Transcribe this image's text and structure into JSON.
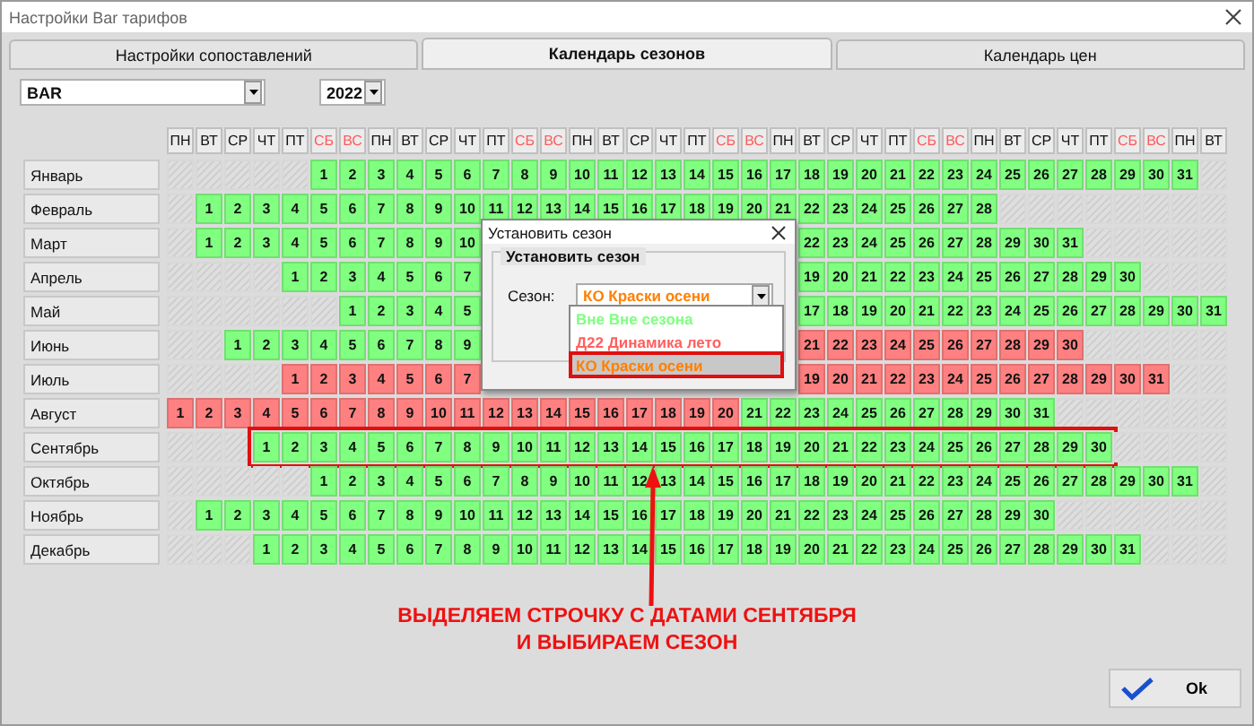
{
  "window": {
    "title": "Настройки Bar тарифов"
  },
  "tabs": [
    {
      "label": "Настройки сопоставлений",
      "selected": false
    },
    {
      "label": "Календарь сезонов",
      "selected": true
    },
    {
      "label": "Календарь цен",
      "selected": false
    }
  ],
  "tariff_select": {
    "value": "BAR"
  },
  "year_select": {
    "value": "2022"
  },
  "weekdays": [
    {
      "label": "ПН",
      "weekend": false
    },
    {
      "label": "ВТ",
      "weekend": false
    },
    {
      "label": "СР",
      "weekend": false
    },
    {
      "label": "ЧТ",
      "weekend": false
    },
    {
      "label": "ПТ",
      "weekend": false
    },
    {
      "label": "СБ",
      "weekend": true
    },
    {
      "label": "ВС",
      "weekend": true
    },
    {
      "label": "ПН",
      "weekend": false
    },
    {
      "label": "ВТ",
      "weekend": false
    },
    {
      "label": "СР",
      "weekend": false
    },
    {
      "label": "ЧТ",
      "weekend": false
    },
    {
      "label": "ПТ",
      "weekend": false
    },
    {
      "label": "СБ",
      "weekend": true
    },
    {
      "label": "ВС",
      "weekend": true
    },
    {
      "label": "ПН",
      "weekend": false
    },
    {
      "label": "ВТ",
      "weekend": false
    },
    {
      "label": "СР",
      "weekend": false
    },
    {
      "label": "ЧТ",
      "weekend": false
    },
    {
      "label": "ПТ",
      "weekend": false
    },
    {
      "label": "СБ",
      "weekend": true
    },
    {
      "label": "ВС",
      "weekend": true
    },
    {
      "label": "ПН",
      "weekend": false
    },
    {
      "label": "ВТ",
      "weekend": false
    },
    {
      "label": "СР",
      "weekend": false
    },
    {
      "label": "ЧТ",
      "weekend": false
    },
    {
      "label": "ПТ",
      "weekend": false
    },
    {
      "label": "СБ",
      "weekend": true
    },
    {
      "label": "ВС",
      "weekend": true
    },
    {
      "label": "ПН",
      "weekend": false
    },
    {
      "label": "ВТ",
      "weekend": false
    },
    {
      "label": "СР",
      "weekend": false
    },
    {
      "label": "ЧТ",
      "weekend": false
    },
    {
      "label": "ПТ",
      "weekend": false
    },
    {
      "label": "СБ",
      "weekend": true
    },
    {
      "label": "ВС",
      "weekend": true
    },
    {
      "label": "ПН",
      "weekend": false
    },
    {
      "label": "ВТ",
      "weekend": false
    }
  ],
  "months": [
    {
      "name": "Январь",
      "selected": false,
      "runs": [
        {
          "kind": "days",
          "color": "#80ff80",
          "days": [
            "1",
            "2",
            "3",
            "4",
            "5",
            "6",
            "7",
            "8",
            "9",
            "10",
            "11",
            "12",
            "13",
            "14",
            "15",
            "16",
            "17",
            "18",
            "19",
            "20",
            "21",
            "22",
            "23",
            "24",
            "25",
            "26",
            "27",
            "28",
            "29",
            "30",
            "31"
          ]
        }
      ]
    },
    {
      "name": "Февраль",
      "selected": false,
      "runs": [
        {
          "kind": "days",
          "color": "#80ff80",
          "days": [
            "1",
            "2",
            "3",
            "4",
            "5",
            "6",
            "7",
            "8",
            "9",
            "10",
            "11",
            "12",
            "13",
            "14",
            "15",
            "16",
            "17",
            "18",
            "19",
            "20",
            "21",
            "22",
            "23",
            "24",
            "25",
            "26",
            "27",
            "28"
          ]
        }
      ]
    },
    {
      "name": "Март",
      "selected": false,
      "runs": [
        {
          "kind": "days",
          "color": "#80ff80",
          "days": [
            "1",
            "2",
            "3",
            "4",
            "5",
            "6",
            "7",
            "8",
            "9",
            "10"
          ]
        },
        {
          "kind": "covered"
        },
        {
          "kind": "days",
          "color": "#80ff80",
          "days": [
            "22",
            "23",
            "24",
            "25",
            "26",
            "27",
            "28",
            "29",
            "30",
            "31"
          ]
        }
      ]
    },
    {
      "name": "Апрель",
      "selected": false,
      "runs": [
        {
          "kind": "days",
          "color": "#80ff80",
          "days": [
            "1",
            "2",
            "3",
            "4",
            "5",
            "6",
            "7"
          ]
        },
        {
          "kind": "covered"
        },
        {
          "kind": "days",
          "color": "#80ff80",
          "days": [
            "19",
            "20",
            "21",
            "22",
            "23",
            "24",
            "25",
            "26",
            "27",
            "28",
            "29",
            "30"
          ]
        }
      ]
    },
    {
      "name": "Май",
      "selected": false,
      "runs": [
        {
          "kind": "days",
          "color": "#80ff80",
          "days": [
            "1",
            "2",
            "3",
            "4",
            "5"
          ]
        },
        {
          "kind": "covered"
        },
        {
          "kind": "days",
          "color": "#80ff80",
          "days": [
            "17",
            "18",
            "19",
            "20",
            "21",
            "22",
            "23",
            "24",
            "25",
            "26",
            "27",
            "28",
            "29",
            "30",
            "31"
          ]
        }
      ]
    },
    {
      "name": "Июнь",
      "selected": false,
      "runs": [
        {
          "kind": "days",
          "color": "#80ff80",
          "days": [
            "1",
            "2",
            "3",
            "4",
            "5",
            "6",
            "7",
            "8",
            "9"
          ]
        },
        {
          "kind": "covered"
        },
        {
          "kind": "days",
          "color": "#ff8080",
          "days": [
            "21",
            "22",
            "23",
            "24",
            "25",
            "26",
            "27",
            "28",
            "29",
            "30"
          ]
        }
      ]
    },
    {
      "name": "Июль",
      "selected": false,
      "runs": [
        {
          "kind": "days",
          "color": "#ff8080",
          "days": [
            "1",
            "2",
            "3",
            "4",
            "5",
            "6",
            "7"
          ]
        },
        {
          "kind": "covered"
        },
        {
          "kind": "days",
          "color": "#ff8080",
          "days": [
            "19",
            "20",
            "21",
            "22",
            "23",
            "24",
            "25",
            "26",
            "27",
            "28",
            "29",
            "30",
            "31"
          ]
        }
      ]
    },
    {
      "name": "Август",
      "selected": false,
      "runs": [
        {
          "kind": "days",
          "color": "#ff8080",
          "days": [
            "1",
            "2",
            "3",
            "4",
            "5",
            "6",
            "7",
            "8",
            "9",
            "10",
            "11",
            "12",
            "13",
            "14",
            "15",
            "16",
            "17",
            "18",
            "19",
            "20"
          ]
        },
        {
          "kind": "days",
          "color": "#80ff80",
          "days": [
            "21",
            "22",
            "23",
            "24",
            "25",
            "26",
            "27",
            "28",
            "29",
            "30",
            "31"
          ]
        }
      ]
    },
    {
      "name": "Сентябрь",
      "selected": true,
      "runs": [
        {
          "kind": "days",
          "color": "#80ff80",
          "days": [
            "1",
            "2",
            "3",
            "4",
            "5",
            "6",
            "7",
            "8",
            "9",
            "10",
            "11",
            "12",
            "13",
            "14",
            "15",
            "16",
            "17",
            "18",
            "19",
            "20",
            "21",
            "22",
            "23",
            "24",
            "25",
            "26",
            "27",
            "28",
            "29",
            "30"
          ]
        }
      ]
    },
    {
      "name": "Октябрь",
      "selected": false,
      "runs": [
        {
          "kind": "days",
          "color": "#80ff80",
          "days": [
            "1",
            "2",
            "3",
            "4",
            "5",
            "6",
            "7",
            "8",
            "9",
            "10",
            "11",
            "12",
            "13",
            "14",
            "15",
            "16",
            "17",
            "18",
            "19",
            "20",
            "21",
            "22",
            "23",
            "24",
            "25",
            "26",
            "27",
            "28",
            "29",
            "30",
            "31"
          ]
        }
      ]
    },
    {
      "name": "Ноябрь",
      "selected": false,
      "runs": [
        {
          "kind": "days",
          "color": "#80ff80",
          "days": [
            "1",
            "2",
            "3",
            "4",
            "5",
            "6",
            "7",
            "8",
            "9",
            "10",
            "11",
            "12",
            "13",
            "14",
            "15",
            "16",
            "17",
            "18",
            "19",
            "20",
            "21",
            "22",
            "23",
            "24",
            "25",
            "26",
            "27",
            "28",
            "29",
            "30"
          ]
        }
      ]
    },
    {
      "name": "Декабрь",
      "selected": false,
      "runs": [
        {
          "kind": "days",
          "color": "#80ff80",
          "days": [
            "1",
            "2",
            "3",
            "4",
            "5",
            "6",
            "7",
            "8",
            "9",
            "10",
            "11",
            "12",
            "13",
            "14",
            "15",
            "16",
            "17",
            "18",
            "19",
            "20",
            "21",
            "22",
            "23",
            "24",
            "25",
            "26",
            "27",
            "28",
            "29",
            "30",
            "31"
          ]
        }
      ]
    }
  ],
  "dialog": {
    "title": "Установить сезон",
    "group_title": "Установить сезон",
    "field_label": "Сезон:",
    "value": "КО Краски осени",
    "options": [
      {
        "label": "Вне Вне сезона",
        "color": "#80ff80",
        "selected": false
      },
      {
        "label": "Д22 Динамика лето",
        "color": "#ff6060",
        "selected": false
      },
      {
        "label": "КО Краски осени",
        "color": "#ff8000",
        "selected": true
      }
    ]
  },
  "annotation": {
    "lines": [
      "ВЫДЕЛЯЕМ СТРОЧКУ С ДАТАМИ СЕНТЯБРЯ",
      "И ВЫБИРАЕМ СЕЗОН"
    ]
  },
  "ok_button": {
    "label": "Ok"
  }
}
